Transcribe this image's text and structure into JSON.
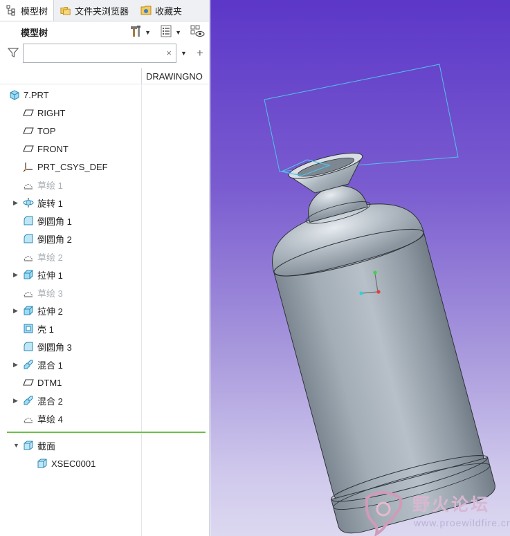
{
  "tabs": [
    {
      "label": "模型树",
      "icon": "model-tree-icon",
      "active": true
    },
    {
      "label": "文件夹浏览器",
      "icon": "folder-browser-icon",
      "active": false
    },
    {
      "label": "收藏夹",
      "icon": "favorites-icon",
      "active": false
    }
  ],
  "header": {
    "title": "模型树"
  },
  "search": {
    "value": "",
    "placeholder": "",
    "clear_glyph": "×"
  },
  "columns": {
    "name": "DRAWINGNO"
  },
  "tree": [
    {
      "label": "7.PRT",
      "icon": "part-icon",
      "dim": false,
      "expandable": false
    },
    {
      "label": "RIGHT",
      "icon": "datum-plane-icon",
      "dim": false,
      "expandable": false
    },
    {
      "label": "TOP",
      "icon": "datum-plane-icon",
      "dim": false,
      "expandable": false
    },
    {
      "label": "FRONT",
      "icon": "datum-plane-icon",
      "dim": false,
      "expandable": false
    },
    {
      "label": "PRT_CSYS_DEF",
      "icon": "coordinate-system-icon",
      "dim": false,
      "expandable": false
    },
    {
      "label": "草绘 1",
      "icon": "sketch-icon",
      "dim": true,
      "expandable": false
    },
    {
      "label": "旋转 1",
      "icon": "revolve-icon",
      "dim": false,
      "expandable": true
    },
    {
      "label": "倒圆角 1",
      "icon": "round-icon",
      "dim": false,
      "expandable": false
    },
    {
      "label": "倒圆角 2",
      "icon": "round-icon",
      "dim": false,
      "expandable": false
    },
    {
      "label": "草绘 2",
      "icon": "sketch-icon",
      "dim": true,
      "expandable": false
    },
    {
      "label": "拉伸 1",
      "icon": "extrude-icon",
      "dim": false,
      "expandable": true
    },
    {
      "label": "草绘 3",
      "icon": "sketch-icon",
      "dim": true,
      "expandable": false
    },
    {
      "label": "拉伸 2",
      "icon": "extrude-icon",
      "dim": false,
      "expandable": true
    },
    {
      "label": "壳 1",
      "icon": "shell-icon",
      "dim": false,
      "expandable": false
    },
    {
      "label": "倒圆角 3",
      "icon": "round-icon",
      "dim": false,
      "expandable": false
    },
    {
      "label": "混合 1",
      "icon": "blend-icon",
      "dim": false,
      "expandable": true
    },
    {
      "label": "DTM1",
      "icon": "datum-plane-icon",
      "dim": false,
      "expandable": false
    },
    {
      "label": "混合 2",
      "icon": "blend-icon",
      "dim": false,
      "expandable": true
    },
    {
      "label": "草绘 4",
      "icon": "sketch-icon",
      "dim": false,
      "expandable": false
    }
  ],
  "sections": {
    "group": {
      "label": "截面",
      "icon": "section-icon",
      "expanded": true
    },
    "items": [
      {
        "label": "XSEC0001",
        "icon": "section-icon"
      }
    ]
  },
  "watermark": {
    "title": "野火论坛",
    "url": "www.proewildfire.cn"
  },
  "colors": {
    "separator": "#6cbf4a",
    "tree_highlight_plane": "#4fc3e8"
  }
}
